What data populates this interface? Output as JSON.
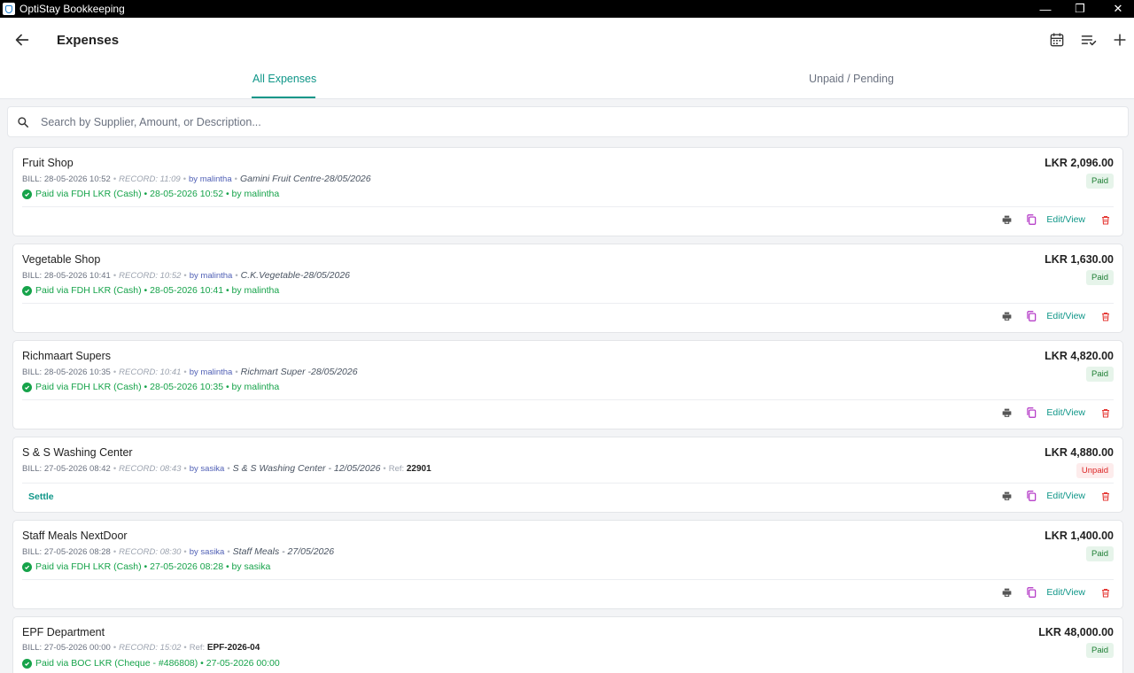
{
  "window": {
    "title": "OptiStay Bookkeeping",
    "minimize": "—",
    "maximize": "❐",
    "close": "✕"
  },
  "header": {
    "title": "Expenses"
  },
  "tabs": [
    {
      "label": "All Expenses"
    },
    {
      "label": "Unpaid / Pending"
    }
  ],
  "search": {
    "placeholder": "Search by Supplier, Amount, or Description..."
  },
  "action_labels": {
    "edit_view": "Edit/View",
    "settle": "Settle"
  },
  "colors": {
    "accent": "#0f9688",
    "paid": "#1e7e34",
    "unpaid": "#dc2626",
    "delete": "#e53935",
    "copy": "#b02fc4"
  },
  "expenses": [
    {
      "name": "Fruit Shop",
      "bill": "BILL: 28-05-2026 10:52",
      "record": "RECORD: 11:09",
      "by": "by malintha",
      "desc": "Gamini Fruit Centre-28/05/2026",
      "ref_label": "",
      "ref": "",
      "amount": "LKR 2,096.00",
      "status": "Paid",
      "payment": "Paid via FDH LKR (Cash) • 28-05-2026 10:52 • by malintha"
    },
    {
      "name": "Vegetable Shop",
      "bill": "BILL: 28-05-2026 10:41",
      "record": "RECORD: 10:52",
      "by": "by malintha",
      "desc": "C.K.Vegetable-28/05/2026",
      "ref_label": "",
      "ref": "",
      "amount": "LKR 1,630.00",
      "status": "Paid",
      "payment": "Paid via FDH LKR (Cash) • 28-05-2026 10:41 • by malintha"
    },
    {
      "name": "Richmaart Supers",
      "bill": "BILL: 28-05-2026 10:35",
      "record": "RECORD: 10:41",
      "by": "by malintha",
      "desc": "Richmart Super -28/05/2026",
      "ref_label": "",
      "ref": "",
      "amount": "LKR 4,820.00",
      "status": "Paid",
      "payment": "Paid via FDH LKR (Cash) • 28-05-2026 10:35 • by malintha"
    },
    {
      "name": "S & S Washing Center",
      "bill": "BILL: 27-05-2026 08:42",
      "record": "RECORD: 08:43",
      "by": "by sasika",
      "desc": "S & S Washing Center - 12/05/2026",
      "ref_label": "Ref:",
      "ref": "22901",
      "amount": "LKR 4,880.00",
      "status": "Unpaid",
      "payment": ""
    },
    {
      "name": "Staff Meals NextDoor",
      "bill": "BILL: 27-05-2026 08:28",
      "record": "RECORD: 08:30",
      "by": "by sasika",
      "desc": "Staff Meals - 27/05/2026",
      "ref_label": "",
      "ref": "",
      "amount": "LKR 1,400.00",
      "status": "Paid",
      "payment": "Paid via FDH LKR (Cash) • 27-05-2026 08:28 • by sasika"
    },
    {
      "name": "EPF Department",
      "bill": "BILL: 27-05-2026 00:00",
      "record": "RECORD: 15:02",
      "by": "",
      "desc": "",
      "ref_label": "Ref:",
      "ref": "EPF-2026-04",
      "amount": "LKR 48,000.00",
      "status": "Paid",
      "payment": "Paid via BOC LKR (Cheque - #486808) • 27-05-2026 00:00"
    }
  ]
}
